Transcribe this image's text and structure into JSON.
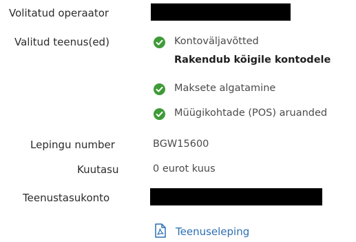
{
  "authorized_operator": {
    "label": "Volitatud operaator",
    "value": ""
  },
  "selected_services": {
    "label": "Valitud teenus(ed)",
    "items": [
      {
        "name": "Kontoväljavõtted",
        "note": "Rakendub kõigile kontodele"
      },
      {
        "name": "Maksete algatamine"
      },
      {
        "name": "Müügikohtade (POS) aruanded"
      }
    ]
  },
  "contract_number": {
    "label": "Lepingu number",
    "value": "BGW15600"
  },
  "monthly_fee": {
    "label": "Kuutasu",
    "value": "0 eurot kuus"
  },
  "service_account": {
    "label": "Teenustasukonto",
    "value": ""
  },
  "contract_link": {
    "label": "Teenuseleping",
    "icon": "pdf-file-icon"
  },
  "colors": {
    "check": "#3f9b38",
    "link": "#2c6fb0",
    "redaction": "#000000"
  }
}
